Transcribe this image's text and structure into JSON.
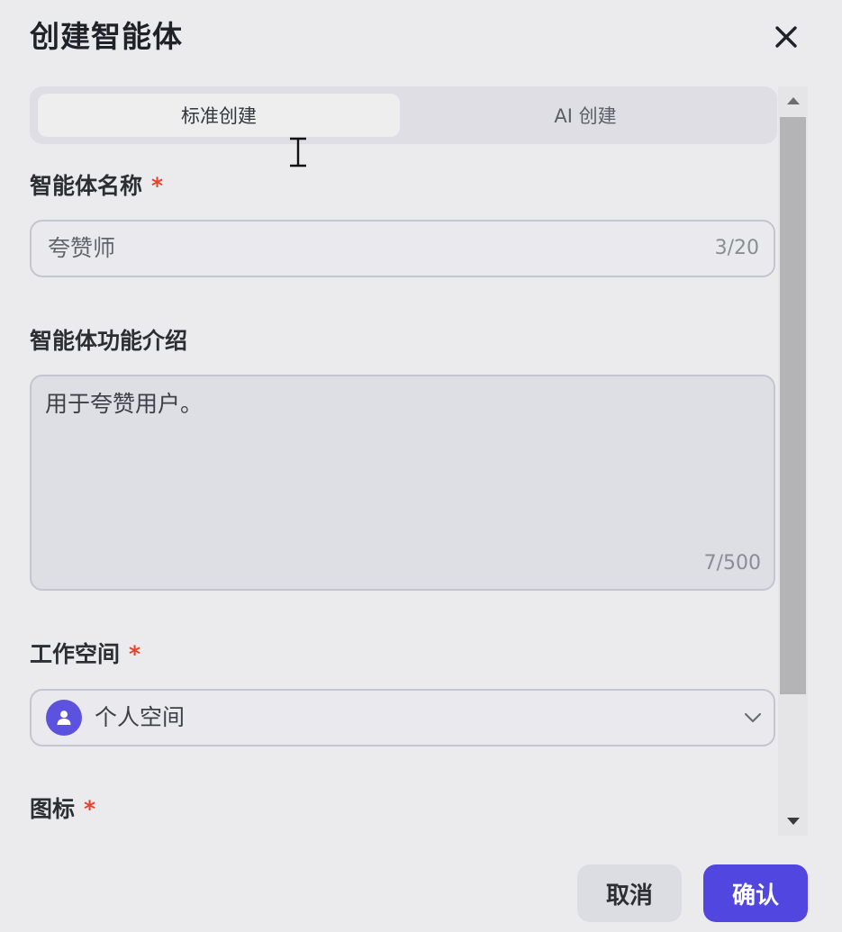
{
  "dialog": {
    "title": "创建智能体",
    "close_icon": "close-icon"
  },
  "tabs": [
    {
      "label": "标准创建",
      "active": true
    },
    {
      "label": "AI 创建",
      "active": false
    }
  ],
  "form": {
    "name": {
      "label": "智能体名称",
      "required_mark": "*",
      "value": "夸赞师",
      "counter": "3/20"
    },
    "description": {
      "label": "智能体功能介绍",
      "value": "用于夸赞用户。",
      "counter": "7/500"
    },
    "workspace": {
      "label": "工作空间",
      "required_mark": "*",
      "selected": "个人空间",
      "avatar_icon": "user-icon",
      "dropdown_icon": "chevron-down-icon"
    },
    "icon": {
      "label": "图标",
      "required_mark": "*"
    }
  },
  "footer": {
    "cancel_label": "取消",
    "confirm_label": "确认"
  },
  "colors": {
    "accent": "#5147e0",
    "required": "#e4432d",
    "background": "#ebebee"
  }
}
